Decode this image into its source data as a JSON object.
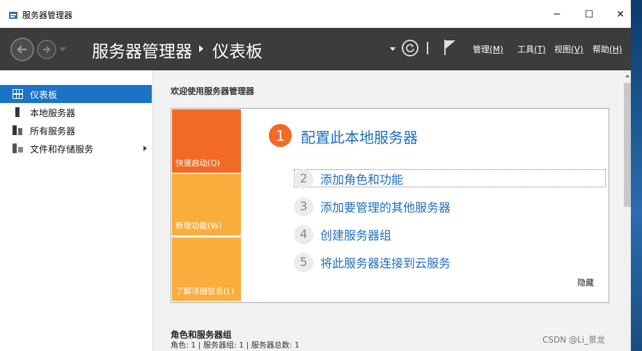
{
  "window": {
    "title": "服务器管理器",
    "controls": {
      "minimize": "─",
      "maximize": "☐",
      "close": "✕"
    }
  },
  "header": {
    "breadcrumb": [
      "服务器管理器",
      "仪表板"
    ],
    "menus": [
      {
        "label": "管理",
        "accesskey": "(M)"
      },
      {
        "label": "工具",
        "accesskey": "(T)"
      },
      {
        "label": "视图",
        "accesskey": "(V)"
      },
      {
        "label": "帮助",
        "accesskey": "(H)"
      }
    ],
    "icons": {
      "back": "back-arrow-icon",
      "forward": "forward-arrow-icon",
      "refresh": "refresh-icon",
      "notifications": "flag-icon"
    }
  },
  "sidebar": {
    "items": [
      {
        "label": "仪表板",
        "icon": "dashboard-grid-icon",
        "active": true
      },
      {
        "label": "本地服务器",
        "icon": "server-icon",
        "active": false
      },
      {
        "label": "所有服务器",
        "icon": "servers-icon",
        "active": false
      },
      {
        "label": "文件和存储服务",
        "icon": "storage-icon",
        "active": false,
        "has_submenu": true
      }
    ]
  },
  "main": {
    "welcome_title": "欢迎使用服务器管理器",
    "tiles": [
      {
        "label": "快速启动(Q)",
        "color": "#f26b26"
      },
      {
        "label": "新增功能(W)",
        "color": "#f8ad3c"
      },
      {
        "label": "了解详细信息(L)",
        "color": "#f8ad3c"
      }
    ],
    "primary_step": {
      "number": "1",
      "label": "配置此本地服务器"
    },
    "steps": [
      {
        "number": "2",
        "label": "添加角色和功能"
      },
      {
        "number": "3",
        "label": "添加要管理的其他服务器"
      },
      {
        "number": "4",
        "label": "创建服务器组"
      },
      {
        "number": "5",
        "label": "将此服务器连接到云服务"
      }
    ],
    "hide_label": "隐藏",
    "roles_title": "角色和服务器组",
    "roles_summary": "角色: 1 | 服务器组: 1 | 服务器总数: 1"
  },
  "watermark": "CSDN @Li_景龙",
  "colors": {
    "accent": "#1a73c4",
    "header_bg": "#3c3c3c",
    "link": "#1f6fbf",
    "orange": "#f26b26",
    "amber": "#f8ad3c"
  }
}
